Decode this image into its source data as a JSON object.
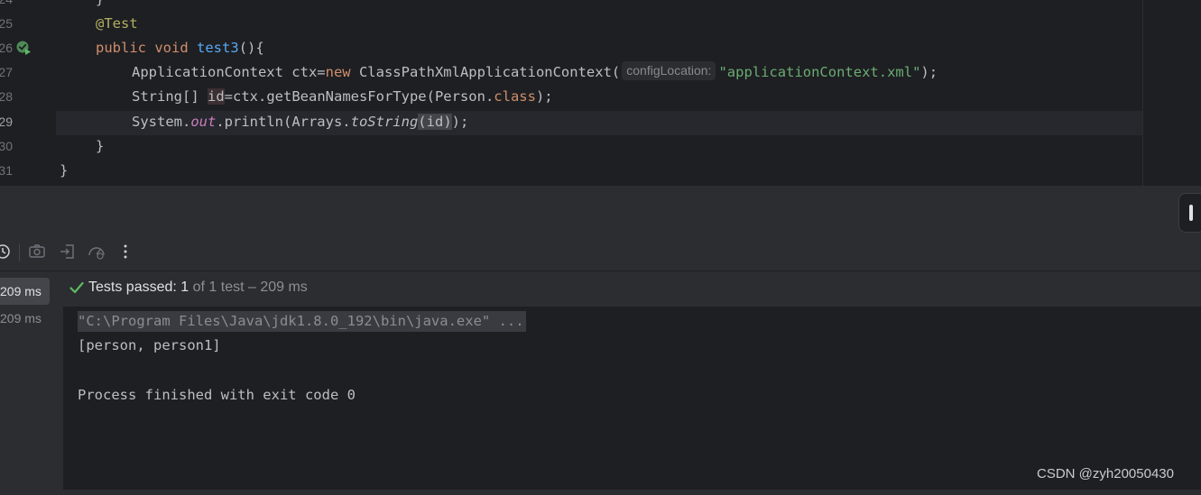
{
  "editor": {
    "line_numbers": [
      "24",
      "25",
      "26",
      "27",
      "28",
      "29",
      "30",
      "31"
    ],
    "current_line": "29",
    "lines": {
      "l24": "}",
      "l25_annotation": "@Test",
      "l26_kw1": "public",
      "l26_kw2": "void",
      "l26_method": "test3",
      "l26_rest": "(){",
      "l27_a": "ApplicationContext ctx=",
      "l27_new": "new",
      "l27_b": " ClassPathXmlApplicationContext(",
      "l27_hint": "configLocation:",
      "l27_str": "\"applicationContext.xml\"",
      "l27_end": ");",
      "l28_a": "String[] ",
      "l28_var": "id",
      "l28_b": "=ctx.getBeanNamesForType(Person.",
      "l28_class": "class",
      "l28_end": ");",
      "l29_a": "System.",
      "l29_out": "out",
      "l29_b": ".println(Arrays.",
      "l29_tostring": "toString",
      "l29_paren": "(",
      "l29_id": "id",
      "l29_close": ")",
      "l29_end": ");",
      "l30": "}",
      "l31": "}"
    }
  },
  "toolbar": {
    "icons": [
      "history-icon",
      "camera-icon",
      "import-icon",
      "speedometer-icon",
      "more-vertical-icon"
    ]
  },
  "tree": {
    "items": [
      {
        "label": "209 ms",
        "selected": true
      },
      {
        "label": "209 ms",
        "selected": false
      }
    ]
  },
  "console": {
    "status": {
      "passed_label": "Tests passed: 1",
      "detail": " of 1 test – 209 ms"
    },
    "output": [
      "\"C:\\Program Files\\Java\\jdk1.8.0_192\\bin\\java.exe\" ...",
      "[person, person1]",
      "",
      "Process finished with exit code 0"
    ]
  },
  "watermark": "CSDN @zyh20050430",
  "colors": {
    "editor_bg": "#1e1f22",
    "panel_bg": "#2b2d30",
    "keyword": "#cf8e6d",
    "annotation": "#b3ae60",
    "method": "#56a8f5",
    "string": "#6aab73",
    "static_field": "#c77dbb",
    "success_green": "#5fb865"
  }
}
